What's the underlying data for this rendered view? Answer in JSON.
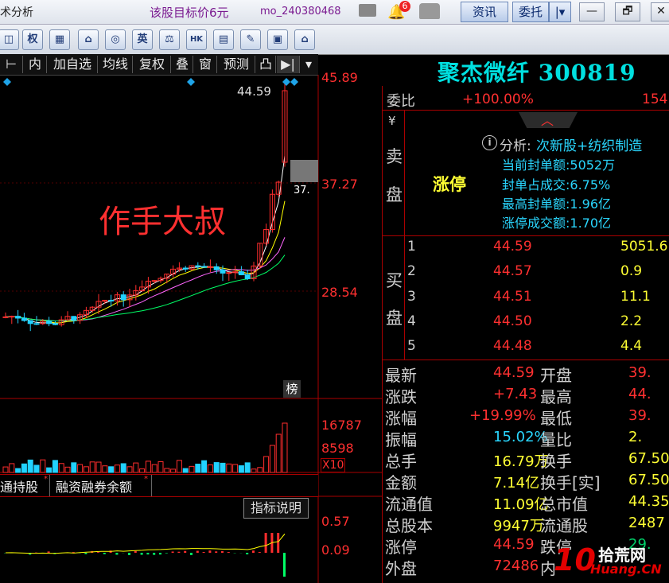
{
  "titlebar": {
    "left_text": "术分析",
    "target_text": "该股目标价6元",
    "user": "mo_240380468",
    "badge_count": "6",
    "info_label": "资讯",
    "trust_label": "委托",
    "trust_arrow": "|▾",
    "minimize": "—",
    "restore": "🗗",
    "close": "✕"
  },
  "toolbar": {
    "buttons": [
      "◫",
      "权",
      "▦",
      "⌂",
      "◎",
      "英",
      "⚖",
      "HK",
      "▤",
      "✎",
      "▣",
      "⌂"
    ]
  },
  "chartbar": {
    "items": [
      "⊢",
      "内",
      "加自选",
      "均线",
      "复权",
      "叠",
      "窗",
      "预测",
      "凸",
      "▶|",
      "▾"
    ]
  },
  "stock": {
    "name_code": "聚杰微纤 300819"
  },
  "kline": {
    "price_high_label": "45.89",
    "price_mid_label": "37.27",
    "price_low_label": "28.54",
    "peak_label": "44.59",
    "current_marker": "37.",
    "watermark": "作手大叔",
    "bang_label": "榜",
    "colors": {
      "up": "#ff2d2d",
      "down": "#21d2ff",
      "ma5": "#ffffff",
      "ma10": "#ffff00",
      "ma20": "#ff66ff",
      "ma60": "#00ff66"
    }
  },
  "volume": {
    "high_label": "16787",
    "mid_label": "8598",
    "unit_label": "X10"
  },
  "tabs": {
    "tab1": "通持股",
    "tab2": "融资融券余额"
  },
  "indicator": {
    "button": "指标说明",
    "high_label": "0.57",
    "low_label": "0.09"
  },
  "order_book": {
    "ratio_label": "委比",
    "ratio_value": "+100.00%",
    "ratio_extra": "154",
    "sell_label_1": "¥",
    "sell_label_2": "卖",
    "sell_label_3": "盘",
    "limit_up_text": "涨停",
    "analysis_label": "分析:",
    "analysis_value": "次新股+纺织制造",
    "seal_amount": "当前封单额:5052万",
    "seal_ratio": "封单占成交:6.75%",
    "max_seal": "最高封单额:1.96亿",
    "limit_turnover": "涨停成交额:1.70亿",
    "buy_label_1": "买",
    "buy_label_2": "盘",
    "bids": [
      {
        "level": "1",
        "price": "44.59",
        "vol": "5051.6"
      },
      {
        "level": "2",
        "price": "44.57",
        "vol": "0.9"
      },
      {
        "level": "3",
        "price": "44.51",
        "vol": "11.1"
      },
      {
        "level": "4",
        "price": "44.50",
        "vol": "2.2"
      },
      {
        "level": "5",
        "price": "44.48",
        "vol": "4.4"
      }
    ]
  },
  "quotes": {
    "rows": [
      {
        "l1": "最新",
        "v1": "44.59",
        "c1": "red",
        "l2": "开盘",
        "v2": "39.",
        "c2": "red"
      },
      {
        "l1": "涨跌",
        "v1": "+7.43",
        "c1": "red",
        "l2": "最高",
        "v2": "44.",
        "c2": "red"
      },
      {
        "l1": "涨幅",
        "v1": "+19.99%",
        "c1": "red",
        "l2": "最低",
        "v2": "39.",
        "c2": "red"
      },
      {
        "l1": "振幅",
        "v1": "15.02%",
        "c1": "cyan",
        "l2": "量比",
        "v2": "2.",
        "c2": "yel"
      },
      {
        "l1": "总手",
        "v1": "16.79万",
        "c1": "yel",
        "l2": "换手",
        "v2": "67.50",
        "c2": "yel"
      },
      {
        "l1": "金额",
        "v1": "7.14亿",
        "c1": "yel",
        "l2": "换手[实]",
        "v2": "67.50",
        "c2": "yel"
      },
      {
        "l1": "流通值",
        "v1": "11.09亿",
        "c1": "yel",
        "l2": "总市值",
        "v2": "44.35",
        "c2": "yel"
      },
      {
        "l1": "总股本",
        "v1": "9947万",
        "c1": "yel",
        "l2": "流通股",
        "v2": "2487",
        "c2": "yel"
      },
      {
        "l1": "涨停",
        "v1": "44.59",
        "c1": "red",
        "l2": "跌停",
        "v2": "29.",
        "c2": "grn"
      },
      {
        "l1": "外盘",
        "v1": "72486",
        "c1": "red",
        "l2": "内",
        "v2": "",
        "c2": "grn"
      }
    ]
  },
  "logo": {
    "text1": "拾荒网",
    "text2": "Huang.CN",
    "num": "10"
  }
}
